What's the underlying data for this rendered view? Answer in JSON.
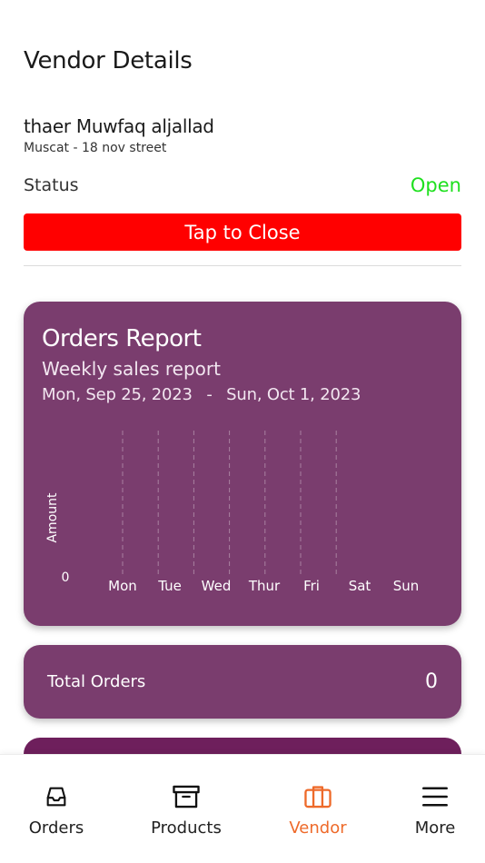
{
  "header": {
    "title": "Vendor Details"
  },
  "vendor": {
    "name": "thaer Muwfaq aljallad",
    "address": "Muscat - 18 nov street",
    "status_label": "Status",
    "status_value": "Open",
    "close_button_label": "Tap to Close"
  },
  "colors": {
    "card": "#7a3d6e",
    "status_open": "#1ee01e",
    "close_button": "#ff0000",
    "nav_active": "#ee6a2a"
  },
  "report": {
    "title": "Orders Report",
    "subtitle": "Weekly sales report",
    "range_start": "Mon, Sep 25, 2023",
    "range_sep": "-",
    "range_end": "Sun, Oct 1, 2023"
  },
  "chart_data": {
    "type": "bar",
    "categories": [
      "Mon",
      "Tue",
      "Wed",
      "Thur",
      "Fri",
      "Sat",
      "Sun"
    ],
    "values": [
      0,
      0,
      0,
      0,
      0,
      0,
      0
    ],
    "ylabel": "Amount",
    "y_ticks": [
      "0"
    ],
    "grid": "vertical-dashed"
  },
  "totals": {
    "label": "Total Orders",
    "value": "0"
  },
  "nav": {
    "items": [
      {
        "label": "Orders",
        "icon": "inbox-icon",
        "active": false
      },
      {
        "label": "Products",
        "icon": "archive-icon",
        "active": false
      },
      {
        "label": "Vendor",
        "icon": "briefcase-icon",
        "active": true
      },
      {
        "label": "More",
        "icon": "menu-icon",
        "active": false
      }
    ]
  }
}
